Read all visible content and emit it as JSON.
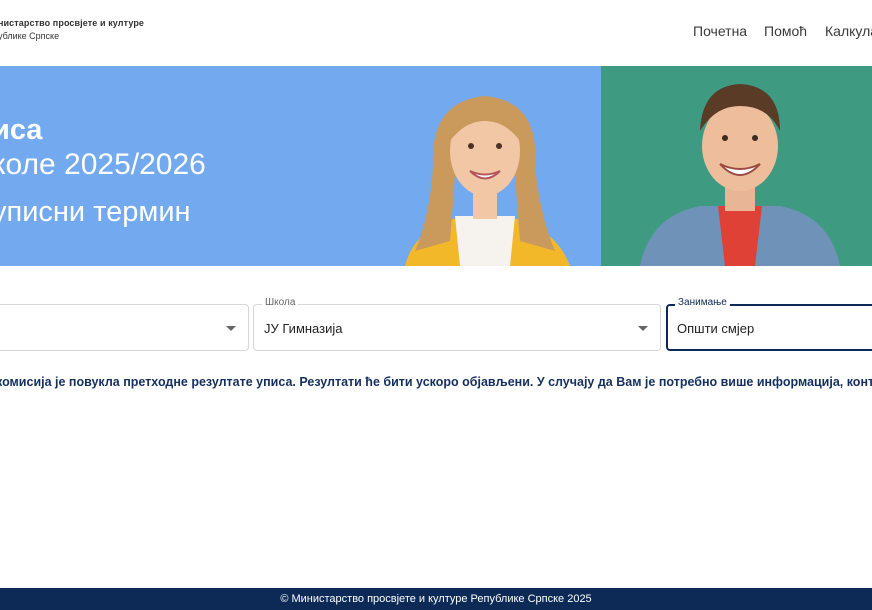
{
  "header": {
    "logo_line1": "нистарство просвјете и културе",
    "logo_line2": "ублике Српске",
    "nav": [
      {
        "label": "Почетна"
      },
      {
        "label": "Помоћ"
      },
      {
        "label": "Калкула"
      }
    ]
  },
  "hero": {
    "line1": "иса",
    "line2": "коле 2025/2026",
    "line3": "уписни термин"
  },
  "filters": {
    "first": {
      "value": ""
    },
    "school": {
      "label": "Школа",
      "value": "ЈУ Гимназија"
    },
    "occupation": {
      "label": "Занимање",
      "value": "Општи смјер"
    }
  },
  "notice": "комисија је повукла претходне резултате уписа. Резултати ће бити ускоро објављени. У случају да Вам је потребно више информација, контакт",
  "footer": "© Министарство просвјете и културе Републике Српске 2025",
  "colors": {
    "hero_blue": "#72a9ef",
    "hero_green": "#3f9a82",
    "footer_bg": "#0d2a57",
    "notice_text": "#15305f"
  }
}
